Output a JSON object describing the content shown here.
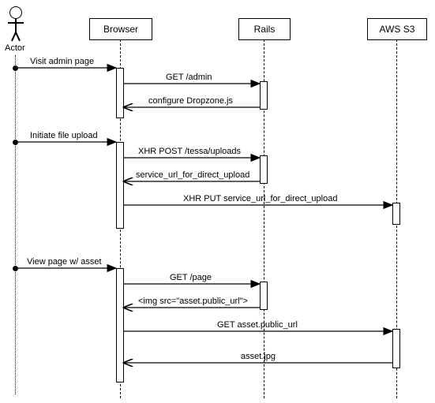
{
  "participants": {
    "actor": "Actor",
    "browser": "Browser",
    "rails": "Rails",
    "s3": "AWS S3"
  },
  "messages": {
    "m1": "Visit admin page",
    "m2": "GET /admin",
    "m3": "configure Dropzone.js",
    "m4": "Initiate file upload",
    "m5": "XHR POST  /tessa/uploads",
    "m6": "service_url_for_direct_upload",
    "m7": "XHR PUT service_url_for_direct_upload",
    "m8": "View page w/ asset",
    "m9": "GET /page",
    "m10": "<img src=\"asset.public_url\">",
    "m11": "GET asset.public_url",
    "m12": "asset.jpg"
  },
  "chart_data": {
    "type": "sequence",
    "participants": [
      "Actor",
      "Browser",
      "Rails",
      "AWS S3"
    ],
    "messages": [
      {
        "from": "Actor",
        "to": "Browser",
        "label": "Visit admin page",
        "kind": "call"
      },
      {
        "from": "Browser",
        "to": "Rails",
        "label": "GET /admin",
        "kind": "call"
      },
      {
        "from": "Rails",
        "to": "Browser",
        "label": "configure Dropzone.js",
        "kind": "return"
      },
      {
        "from": "Actor",
        "to": "Browser",
        "label": "Initiate file upload",
        "kind": "call"
      },
      {
        "from": "Browser",
        "to": "Rails",
        "label": "XHR POST  /tessa/uploads",
        "kind": "call"
      },
      {
        "from": "Rails",
        "to": "Browser",
        "label": "service_url_for_direct_upload",
        "kind": "return"
      },
      {
        "from": "Browser",
        "to": "AWS S3",
        "label": "XHR PUT service_url_for_direct_upload",
        "kind": "call"
      },
      {
        "from": "Actor",
        "to": "Browser",
        "label": "View page w/ asset",
        "kind": "call"
      },
      {
        "from": "Browser",
        "to": "Rails",
        "label": "GET /page",
        "kind": "call"
      },
      {
        "from": "Rails",
        "to": "Browser",
        "label": "<img src=\"asset.public_url\">",
        "kind": "return"
      },
      {
        "from": "Browser",
        "to": "AWS S3",
        "label": "GET asset.public_url",
        "kind": "call"
      },
      {
        "from": "AWS S3",
        "to": "Browser",
        "label": "asset.jpg",
        "kind": "return"
      }
    ]
  }
}
